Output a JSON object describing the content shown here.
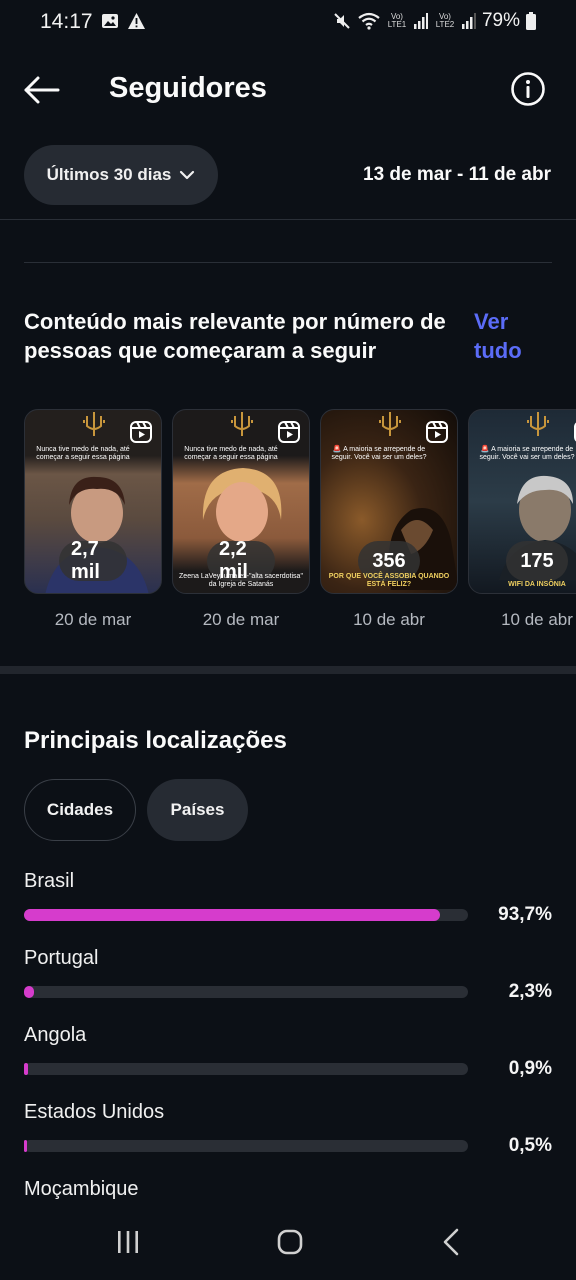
{
  "status": {
    "time": "14:17",
    "battery": "79%",
    "sim1": "Vo) LTE1",
    "sim2": "Vo) LTE2",
    "icons": [
      "gallery-icon",
      "warning-icon",
      "mute-icon",
      "wifi-icon",
      "signal-icon",
      "battery-icon"
    ]
  },
  "header": {
    "title": "Seguidores",
    "back_icon": "arrow-left-icon",
    "info_icon": "info-icon"
  },
  "range": {
    "selector_label": "Últimos 30 dias",
    "dates": "13 de mar - 11 de abr"
  },
  "top_content": {
    "title": "Conteúdo mais relevante por número de pessoas que começaram a seguir",
    "see_all": "Ver tudo",
    "reels": [
      {
        "count": "2,7 mil",
        "date": "20 de mar",
        "caption": "Nunca tive medo de nada, até começar a seguir essa página",
        "bottom_text": "",
        "bg": "#5a4a3f"
      },
      {
        "count": "2,2 mil",
        "date": "20 de mar",
        "caption": "Nunca tive medo de nada, até começar a seguir essa página",
        "bottom_text": "Zeena LaVey, uma ex-\"alta sacerdotisa\" da Igreja de Satanás",
        "bg": "#8b5a3c"
      },
      {
        "count": "356",
        "date": "10 de abr",
        "caption": "🚨 A maioria se arrepende de seguir. Você vai ser um deles?",
        "bottom_text": "POR QUE VOCÊ ASSOBIA QUANDO ESTÁ FELIZ?",
        "bg": "#3a2414"
      },
      {
        "count": "175",
        "date": "10 de abr",
        "caption": "🚨 A maioria se arrepende de seguir. Você vai ser um deles?",
        "bottom_text": "WIFI DA INSÔNIA",
        "bg": "#1e2a36"
      }
    ]
  },
  "locations": {
    "title": "Principais localizações",
    "tabs": [
      "Cidades",
      "Países"
    ],
    "selected_tab": "Países",
    "items": [
      {
        "name": "Brasil",
        "percent": "93,7%",
        "value": 93.7
      },
      {
        "name": "Portugal",
        "percent": "2,3%",
        "value": 2.3
      },
      {
        "name": "Angola",
        "percent": "0,9%",
        "value": 0.9
      },
      {
        "name": "Estados Unidos",
        "percent": "0,5%",
        "value": 0.5
      },
      {
        "name": "Moçambique",
        "percent": "",
        "value": null
      }
    ]
  },
  "navbar": {
    "icons": [
      "recents-icon",
      "home-icon",
      "back-icon"
    ]
  },
  "colors": {
    "background": "#0c1016",
    "accent_link": "#5b6cf7",
    "bar_fill": "#d63ccc",
    "bar_track": "#2a2e35"
  }
}
